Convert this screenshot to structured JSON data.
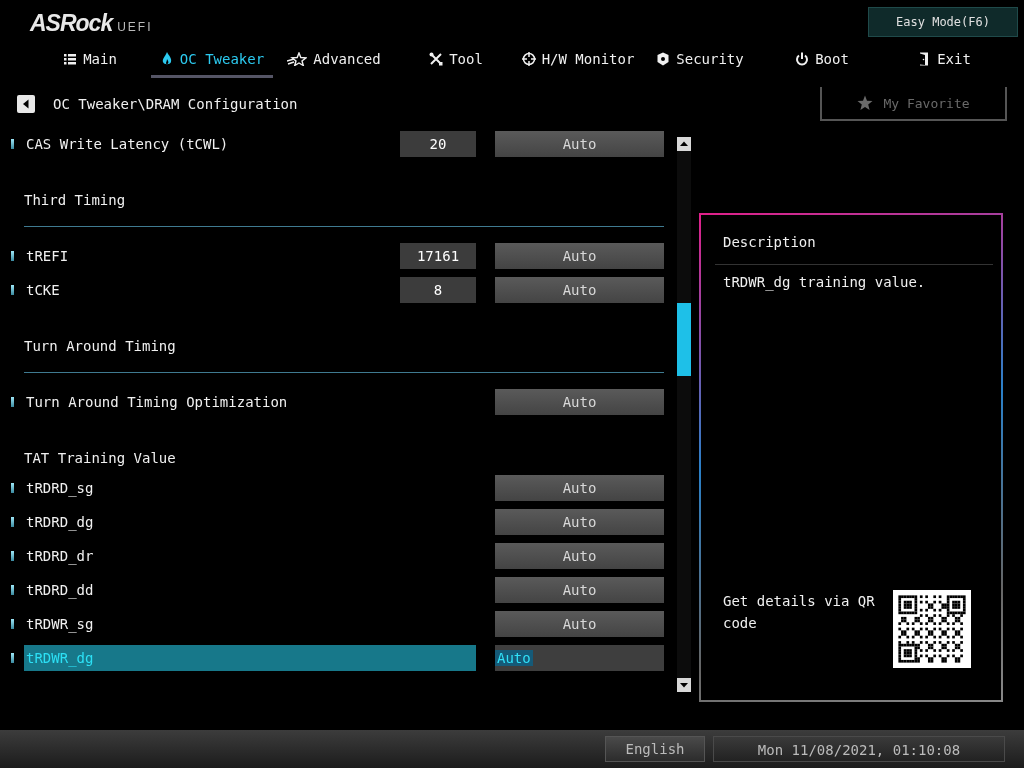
{
  "header": {
    "logo": "ASRock",
    "logo_suffix": "UEFI",
    "easy_mode_button": "Easy Mode(F6)"
  },
  "tabs": [
    {
      "label": "Main",
      "selected": false
    },
    {
      "label": "OC Tweaker",
      "selected": true
    },
    {
      "label": "Advanced",
      "selected": false
    },
    {
      "label": "Tool",
      "selected": false
    },
    {
      "label": "H/W Monitor",
      "selected": false
    },
    {
      "label": "Security",
      "selected": false
    },
    {
      "label": "Boot",
      "selected": false
    },
    {
      "label": "Exit",
      "selected": false
    }
  ],
  "breadcrumb": "OC Tweaker\\DRAM Configuration",
  "favorite_button": "My Favorite",
  "rows": [
    {
      "kind": "setting",
      "label": "CAS Write Latency (tCWL)",
      "value": "20",
      "option": "Auto",
      "selected": false
    },
    {
      "kind": "heading",
      "label": "Third Timing",
      "divider": true
    },
    {
      "kind": "setting",
      "label": "tREFI",
      "value": "17161",
      "option": "Auto",
      "selected": false
    },
    {
      "kind": "setting",
      "label": "tCKE",
      "value": "8",
      "option": "Auto",
      "selected": false
    },
    {
      "kind": "heading",
      "label": "Turn Around Timing",
      "divider": true
    },
    {
      "kind": "setting",
      "label": "Turn Around Timing Optimization",
      "option": "Auto",
      "selected": false
    },
    {
      "kind": "heading",
      "label": "TAT Training Value",
      "divider": false
    },
    {
      "kind": "setting",
      "label": "tRDRD_sg",
      "option": "Auto",
      "selected": false
    },
    {
      "kind": "setting",
      "label": "tRDRD_dg",
      "option": "Auto",
      "selected": false
    },
    {
      "kind": "setting",
      "label": "tRDRD_dr",
      "option": "Auto",
      "selected": false
    },
    {
      "kind": "setting",
      "label": "tRDRD_dd",
      "option": "Auto",
      "selected": false
    },
    {
      "kind": "setting",
      "label": "tRDWR_sg",
      "option": "Auto",
      "selected": false
    },
    {
      "kind": "setting",
      "label": "tRDWR_dg",
      "option": "Auto",
      "selected": true
    }
  ],
  "description": {
    "title": "Description",
    "text": "tRDWR_dg training value.",
    "qr_caption": "Get details via QR code"
  },
  "status_bar": {
    "language": "English",
    "datetime": "Mon 11/08/2021, 01:10:08"
  }
}
